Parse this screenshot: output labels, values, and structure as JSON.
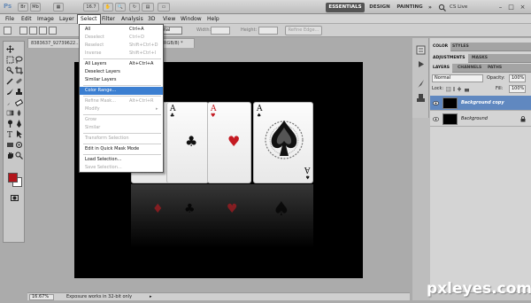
{
  "titlebar": {
    "app": "Ps",
    "zoom": "16.7",
    "workspaces": {
      "active": "ESSENTIALS",
      "design": "DESIGN",
      "painting": "PAINTING",
      "more": "»"
    },
    "cs_live": "CS Live",
    "window_controls": {
      "minimize": "–",
      "restore": "□",
      "close": "×"
    }
  },
  "menubar": {
    "items": [
      "File",
      "Edit",
      "Image",
      "Layer",
      "Select",
      "Filter",
      "Analysis",
      "3D",
      "View",
      "Window",
      "Help"
    ],
    "active": "Select"
  },
  "options": {
    "feather_label": "px",
    "style_value": "rmal",
    "width_label": "Width:",
    "height_label": "Height:",
    "refine_edge": "Refine Edge..."
  },
  "document": {
    "tab_title": "8383637_92739622...",
    "tab_suffix": "RGB/8) *",
    "zoom": "16.67%",
    "status_text": "Exposure works in 32-bit only",
    "status_arrow": "▸"
  },
  "select_menu": {
    "items": [
      {
        "label": "All",
        "shortcut": "Ctrl+A",
        "enabled": true
      },
      {
        "label": "Deselect",
        "shortcut": "Ctrl+D",
        "enabled": false
      },
      {
        "label": "Reselect",
        "shortcut": "Shift+Ctrl+D",
        "enabled": false
      },
      {
        "label": "Inverse",
        "shortcut": "Shift+Ctrl+I",
        "enabled": false
      },
      {
        "label": "All Layers",
        "shortcut": "Alt+Ctrl+A",
        "enabled": true
      },
      {
        "label": "Deselect Layers",
        "shortcut": "",
        "enabled": true
      },
      {
        "label": "Similar Layers",
        "shortcut": "",
        "enabled": true
      },
      {
        "label": "Color Range...",
        "shortcut": "",
        "enabled": true,
        "highlighted": true
      },
      {
        "label": "Refine Mask...",
        "shortcut": "Alt+Ctrl+R",
        "enabled": false
      },
      {
        "label": "Modify",
        "shortcut": "",
        "enabled": false,
        "submenu": true
      },
      {
        "label": "Grow",
        "shortcut": "",
        "enabled": false
      },
      {
        "label": "Similar",
        "shortcut": "",
        "enabled": false
      },
      {
        "label": "Transform Selection",
        "shortcut": "",
        "enabled": false
      },
      {
        "label": "Edit in Quick Mask Mode",
        "shortcut": "",
        "enabled": true
      },
      {
        "label": "Load Selection...",
        "shortcut": "",
        "enabled": true
      },
      {
        "label": "Save Selection...",
        "shortcut": "",
        "enabled": false
      }
    ]
  },
  "cards": [
    {
      "rank": "A",
      "suit": "♦",
      "color": "#c41a22"
    },
    {
      "rank": "A",
      "suit": "♣",
      "color": "#111111"
    },
    {
      "rank": "A",
      "suit": "♥",
      "color": "#c41a22"
    },
    {
      "rank": "A",
      "suit": "♠",
      "color": "#111111"
    }
  ],
  "panels": {
    "top_tabs": [
      "COLOR",
      "STYLES"
    ],
    "mid_tabs": [
      "ADJUSTMENTS",
      "MASKS"
    ],
    "layer_tabs": [
      "LAYERS",
      "CHANNELS",
      "PATHS"
    ],
    "blend_mode": "Normal",
    "opacity_label": "Opacity:",
    "opacity_value": "100%",
    "lock_label": "Lock:",
    "fill_label": "Fill:",
    "fill_value": "100%",
    "layers": [
      {
        "name": "Background copy",
        "selected": true,
        "locked": false
      },
      {
        "name": "Background",
        "selected": false,
        "locked": true
      }
    ]
  },
  "colors": {
    "foreground": "#b2151b",
    "background": "#ffffff",
    "selection": "#3c7fd1"
  },
  "watermark": "pxleyes.com"
}
